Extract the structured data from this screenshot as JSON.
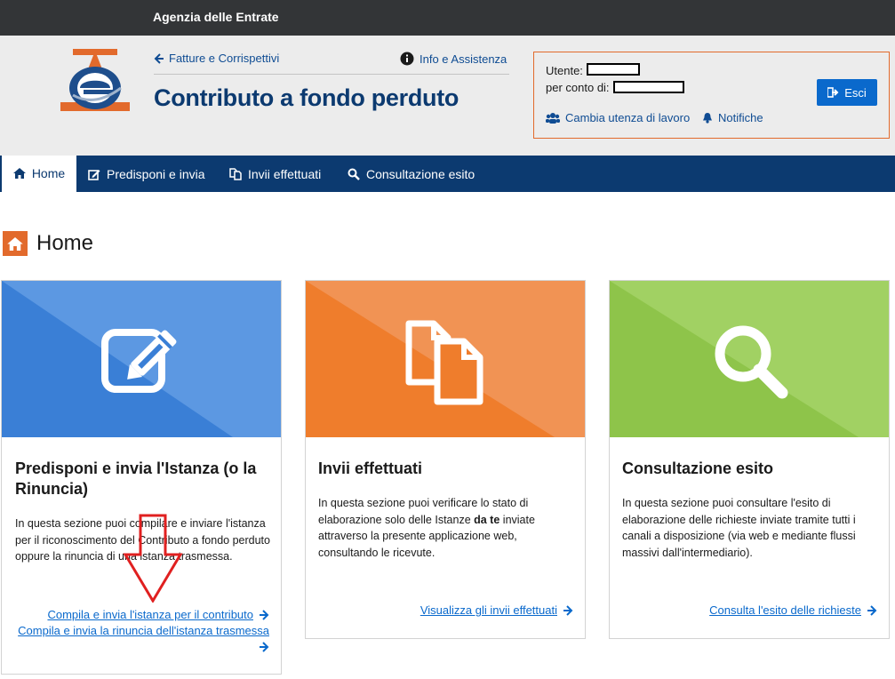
{
  "topbar": {
    "brand": "Agenzia delle Entrate"
  },
  "header": {
    "back_link": "Fatture e Corrispettivi",
    "info_link": "Info e Assistenza",
    "title": "Contributo a fondo perduto"
  },
  "userbox": {
    "user_label": "Utente:",
    "on_behalf_label": "per conto di:",
    "logout_label": "Esci",
    "change_user_link": "Cambia utenza di lavoro",
    "notifications_link": "Notifiche"
  },
  "nav": {
    "items": [
      {
        "label": "Home",
        "icon": "home-icon",
        "active": true
      },
      {
        "label": "Predisponi e invia",
        "icon": "edit-icon",
        "active": false
      },
      {
        "label": "Invii effettuati",
        "icon": "copy-icon",
        "active": false
      },
      {
        "label": "Consultazione esito",
        "icon": "search-icon",
        "active": false
      }
    ]
  },
  "page": {
    "heading": "Home"
  },
  "cards": [
    {
      "title": "Predisponi e invia l'Istanza (o la Rinuncia)",
      "desc": "In questa sezione puoi compilare e inviare l'istanza per il riconoscimento del Contributo a fondo perduto oppure la rinuncia di una istanza trasmessa.",
      "links": [
        "Compila e invia l'istanza per il contributo",
        "Compila e invia la rinuncia dell'istanza trasmessa"
      ],
      "color": "#3f82d8"
    },
    {
      "title": "Invii effettuati",
      "desc_pre": "In questa sezione puoi verificare lo stato di elaborazione solo delle Istanze ",
      "desc_bold": "da te",
      "desc_post": " inviate attraverso la presente applicazione web, consultando le ricevute.",
      "links": [
        "Visualizza gli invii effettuati"
      ],
      "color": "#ee7a2f"
    },
    {
      "title": "Consultazione esito",
      "desc": "In questa sezione puoi consultare l'esito di elaborazione delle richieste inviate tramite tutti i canali a disposizione (via web e mediante flussi massivi dall'intermediario).",
      "links": [
        "Consulta l'esito delle richieste"
      ],
      "color": "#8dc44a"
    }
  ],
  "colors": {
    "accent": "#e26a2c",
    "primary": "#0c3a70",
    "link": "#0a69cc",
    "annotation": "#e02020"
  }
}
